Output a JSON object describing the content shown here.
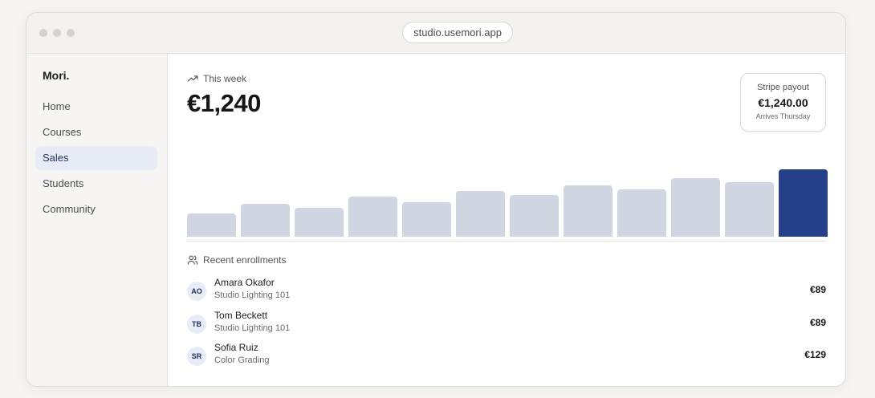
{
  "browser": {
    "url": "studio.usemori.app"
  },
  "sidebar": {
    "brand": "Mori.",
    "items": [
      {
        "label": "Home",
        "active": false
      },
      {
        "label": "Courses",
        "active": false
      },
      {
        "label": "Sales",
        "active": true
      },
      {
        "label": "Students",
        "active": false
      },
      {
        "label": "Community",
        "active": false
      }
    ]
  },
  "summary": {
    "period_label": "This week",
    "total": "€1,240",
    "payout": {
      "label": "Stripe payout",
      "amount": "€1,240.00",
      "note": "Arrives Thursday"
    }
  },
  "chart_data": {
    "type": "bar",
    "values": [
      31,
      45,
      39,
      54,
      47,
      62,
      56,
      70,
      64,
      79,
      74,
      91
    ],
    "highlight_index": 11,
    "colors": {
      "default": "#d1d6e3",
      "highlight": "#26418a"
    }
  },
  "enrollments": {
    "label": "Recent enrollments",
    "rows": [
      {
        "initials": "AO",
        "name": "Amara Okafor",
        "course": "Studio Lighting 101",
        "price": "€89"
      },
      {
        "initials": "TB",
        "name": "Tom Beckett",
        "course": "Studio Lighting 101",
        "price": "€89"
      },
      {
        "initials": "SR",
        "name": "Sofia Ruiz",
        "course": "Color Grading",
        "price": "€129"
      }
    ]
  }
}
